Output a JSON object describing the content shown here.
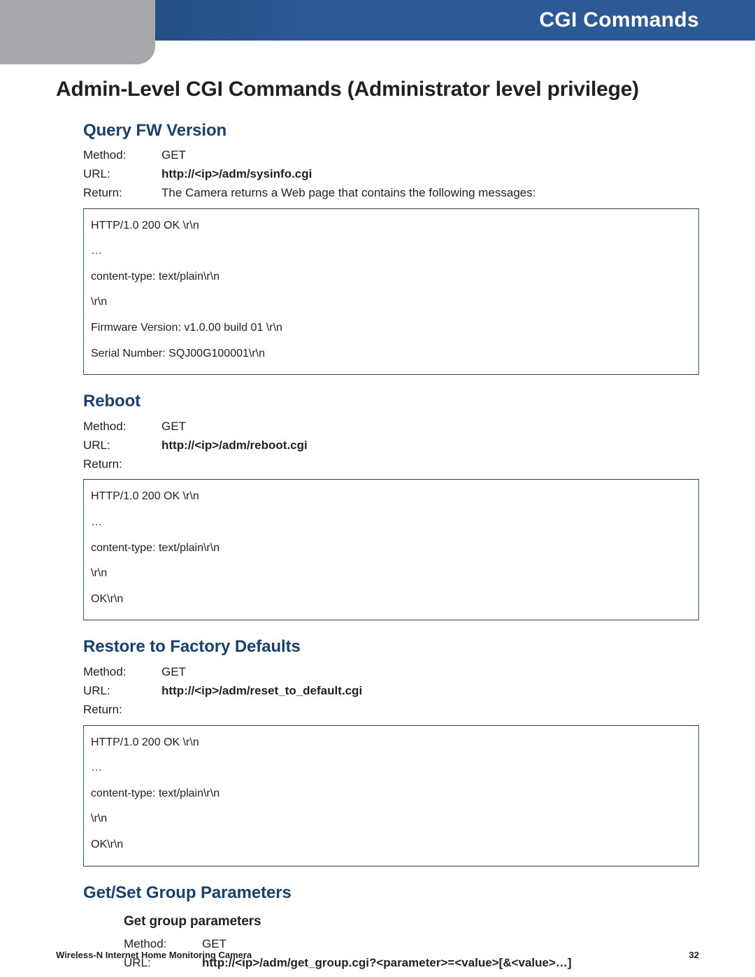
{
  "header": {
    "title": "CGI Commands"
  },
  "page": {
    "title": "Admin-Level CGI Commands (Administrator level privilege)"
  },
  "sections": {
    "query_fw": {
      "heading": "Query FW Version",
      "method_label": "Method:",
      "method": "GET",
      "url_label": "URL:",
      "url": "http://<ip>/adm/sysinfo.cgi",
      "return_label": "Return:",
      "return_desc": "The Camera returns a Web page that contains the following messages:",
      "code": [
        "HTTP/1.0 200 OK \\r\\n",
        "…",
        "content-type: text/plain\\r\\n",
        "\\r\\n",
        "Firmware Version: v1.0.00 build 01 \\r\\n",
        "Serial Number: SQJ00G100001\\r\\n"
      ]
    },
    "reboot": {
      "heading": "Reboot",
      "method_label": "Method:",
      "method": "GET",
      "url_label": "URL:",
      "url": "http://<ip>/adm/reboot.cgi",
      "return_label": "Return:",
      "code": [
        "HTTP/1.0 200 OK \\r\\n",
        "…",
        "content-type: text/plain\\r\\n",
        "\\r\\n",
        "OK\\r\\n"
      ]
    },
    "restore": {
      "heading": "Restore to Factory Defaults",
      "method_label": "Method:",
      "method": "GET",
      "url_label": "URL:",
      "url": "http://<ip>/adm/reset_to_default.cgi",
      "return_label": "Return:",
      "code": [
        "HTTP/1.0 200 OK \\r\\n",
        "…",
        "content-type: text/plain\\r\\n",
        "\\r\\n",
        "OK\\r\\n"
      ]
    },
    "group_params": {
      "heading": "Get/Set Group Parameters",
      "sub": {
        "heading": "Get group parameters",
        "method_label": "Method:",
        "method": "GET",
        "url_label": "URL:",
        "url": "http://<ip>/adm/get_group.cgi?<parameter>=<value>[&<value>…]"
      }
    }
  },
  "footer": {
    "left": "Wireless-N Internet Home Monitoring Camera",
    "right": "32"
  }
}
